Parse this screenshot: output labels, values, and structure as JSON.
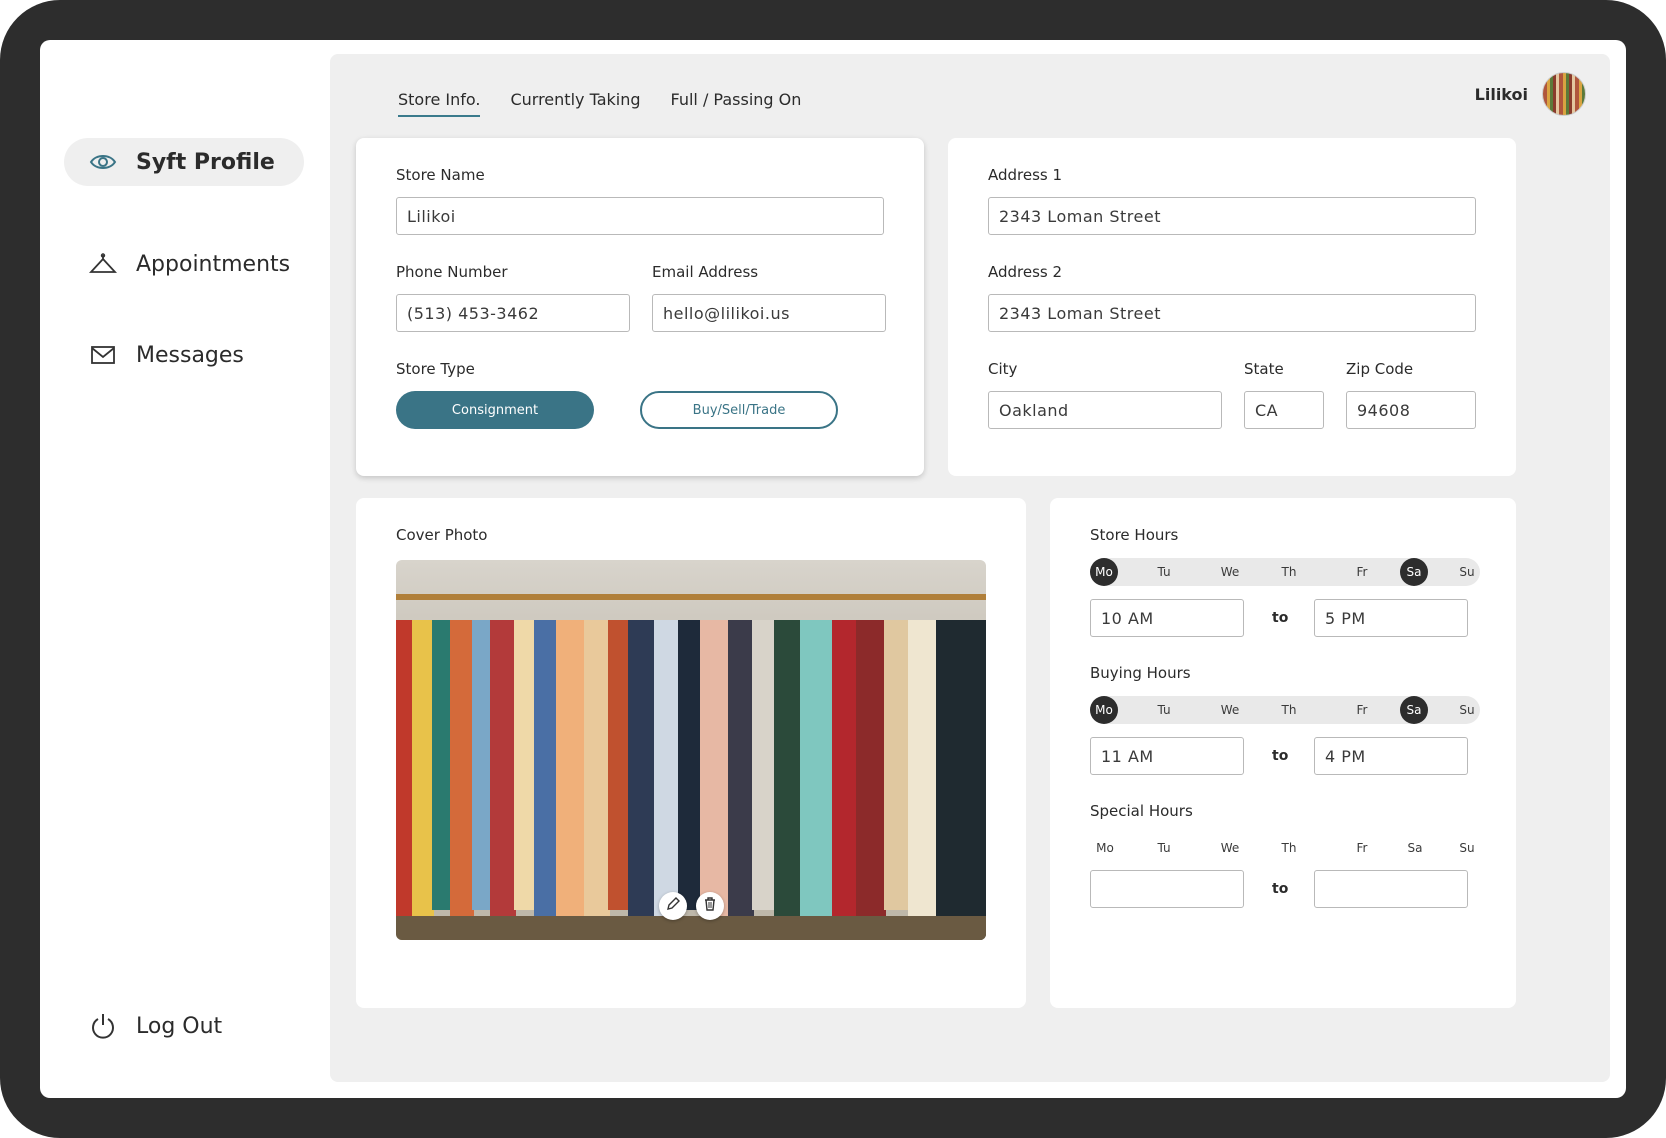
{
  "sidebar": {
    "items": [
      {
        "label": "Syft Profile",
        "icon": "eye-icon"
      },
      {
        "label": "Appointments",
        "icon": "hanger-icon"
      },
      {
        "label": "Messages",
        "icon": "envelope-icon"
      }
    ],
    "logout_label": "Log Out"
  },
  "tabs": [
    "Store Info.",
    "Currently Taking",
    "Full / Passing On"
  ],
  "user": {
    "name": "Lilikoi"
  },
  "store": {
    "name_label": "Store Name",
    "name_value": "Lilikoi",
    "phone_label": "Phone Number",
    "phone_value": "(513) 453-3462",
    "email_label": "Email Address",
    "email_value": "hello@lilikoi.us",
    "type_label": "Store Type",
    "type_options": [
      "Consignment",
      "Buy/Sell/Trade"
    ],
    "type_selected": "Consignment"
  },
  "address": {
    "addr1_label": "Address 1",
    "addr1_value": "2343 Loman Street",
    "addr2_label": "Address 2",
    "addr2_value": "2343 Loman Street",
    "city_label": "City",
    "city_value": "Oakland",
    "state_label": "State",
    "state_value": "CA",
    "zip_label": "Zip Code",
    "zip_value": "94608"
  },
  "cover": {
    "label": "Cover Photo"
  },
  "days": [
    "Mo",
    "Tu",
    "We",
    "Th",
    "Fr",
    "Sa",
    "Su"
  ],
  "hours": {
    "store_label": "Store Hours",
    "store_from": "10 AM",
    "store_to": "5 PM",
    "store_selected": [
      "Mo",
      "Sa"
    ],
    "buying_label": "Buying Hours",
    "buying_from": "11 AM",
    "buying_to": "4 PM",
    "buying_selected": [
      "Mo",
      "Sa"
    ],
    "special_label": "Special Hours",
    "special_from": "",
    "special_to": "",
    "to_label": "to"
  },
  "colors": {
    "accent": "#3a7486",
    "frame": "#2d2d2d",
    "panel": "#efefef"
  }
}
